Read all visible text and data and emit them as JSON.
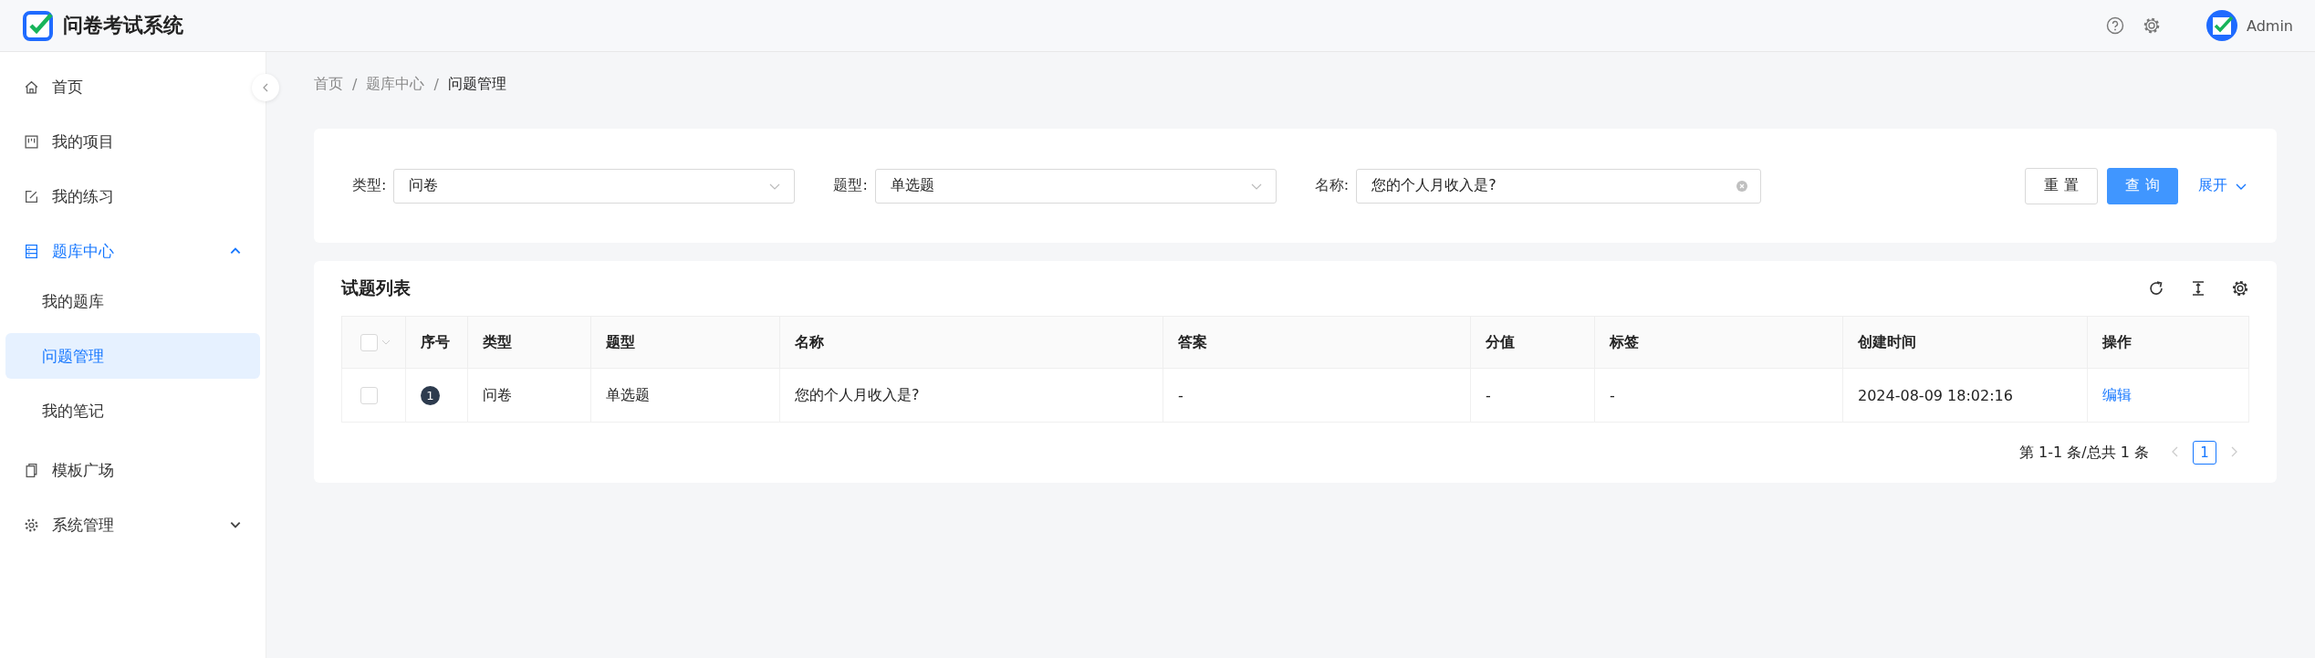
{
  "header": {
    "title": "问卷考试系统",
    "user": "Admin"
  },
  "sidebar": {
    "collapsed": false,
    "items": [
      {
        "label": "首页",
        "selected": false
      },
      {
        "label": "我的项目",
        "selected": false
      },
      {
        "label": "我的练习",
        "selected": false
      },
      {
        "label": "题库中心",
        "selected": true,
        "expanded": true,
        "children": [
          {
            "label": "我的题库",
            "selected": false
          },
          {
            "label": "问题管理",
            "selected": true
          },
          {
            "label": "我的笔记",
            "selected": false
          }
        ]
      },
      {
        "label": "模板广场",
        "selected": false
      },
      {
        "label": "系统管理",
        "selected": false,
        "expanded": false
      }
    ]
  },
  "breadcrumb": [
    "首页",
    "题库中心",
    "问题管理"
  ],
  "breadcrumb_separator": "/",
  "filters": [
    {
      "kind": "select",
      "label": "类型:",
      "value": "问卷"
    },
    {
      "kind": "select",
      "label": "题型:",
      "value": "单选题"
    },
    {
      "kind": "text",
      "label": "名称:",
      "value": "您的个人月收入是?"
    }
  ],
  "filter_buttons": {
    "reset": "重 置",
    "query": "查 询",
    "expand": "展开",
    "expanded": false
  },
  "table": {
    "title": "试题列表",
    "all_checked": false,
    "columns": [
      "",
      "序号",
      "类型",
      "题型",
      "名称",
      "答案",
      "分值",
      "标签",
      "创建时间",
      "操作"
    ],
    "rows": [
      {
        "checked": false,
        "cells": [
          "",
          "1",
          "问卷",
          "单选题",
          "您的个人月收入是?",
          "-",
          "-",
          "-",
          "2024-08-09 18:02:16",
          "编辑"
        ]
      }
    ]
  },
  "pagination": {
    "summary": "第 1-1 条/总共 1 条",
    "prev_disabled": true,
    "next_disabled": true,
    "pages": [
      {
        "label": "1",
        "selected": true
      }
    ]
  }
}
